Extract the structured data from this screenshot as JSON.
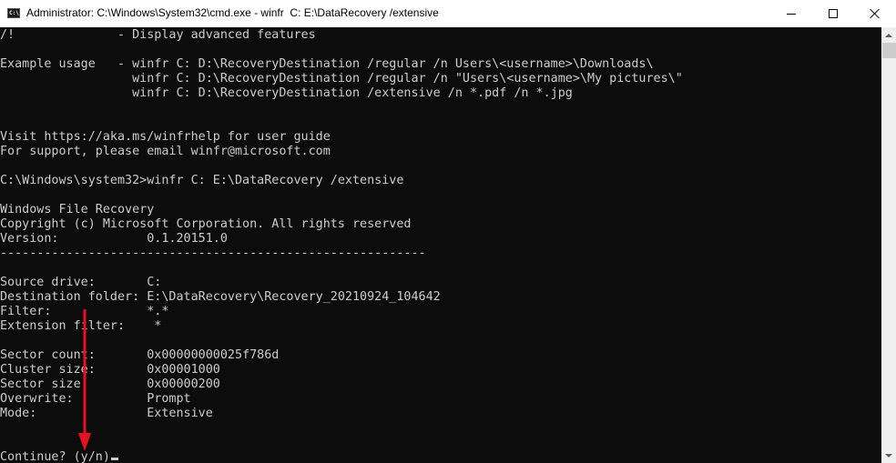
{
  "window": {
    "title": "Administrator: C:\\Windows\\System32\\cmd.exe - winfr  C: E:\\DataRecovery /extensive",
    "icon": "cmd-icon",
    "controls": {
      "minimize": "minimize-icon",
      "maximize": "maximize-icon",
      "close": "close-icon"
    }
  },
  "console": {
    "lines": [
      "/!              - Display advanced features",
      "",
      "Example usage   - winfr C: D:\\RecoveryDestination /regular /n Users\\<username>\\Downloads\\",
      "                  winfr C: D:\\RecoveryDestination /regular /n \"Users\\<username>\\My pictures\\\"",
      "                  winfr C: D:\\RecoveryDestination /extensive /n *.pdf /n *.jpg",
      "",
      "",
      "Visit https://aka.ms/winfrhelp for user guide",
      "For support, please email winfr@microsoft.com",
      "",
      "C:\\Windows\\system32>winfr C: E:\\DataRecovery /extensive",
      "",
      "Windows File Recovery",
      "Copyright (c) Microsoft Corporation. All rights reserved",
      "Version:            0.1.20151.0",
      "----------------------------------------------------------",
      "",
      "Source drive:       C:",
      "Destination folder: E:\\DataRecovery\\Recovery_20210924_104642",
      "Filter:             *.*",
      "Extension filter:    *",
      "",
      "Sector count:       0x00000000025f786d",
      "Cluster size:       0x00001000",
      "Sector size:        0x00000200",
      "Overwrite:          Prompt",
      "Mode:               Extensive",
      "",
      "",
      "Continue? (y/n)"
    ]
  },
  "annotation": {
    "type": "arrow",
    "color": "#e81123",
    "points_to": "Continue? (y/n)"
  },
  "colors": {
    "console_bg": "#0c0c0c",
    "console_fg": "#cccccc",
    "titlebar_bg": "#ffffff"
  }
}
